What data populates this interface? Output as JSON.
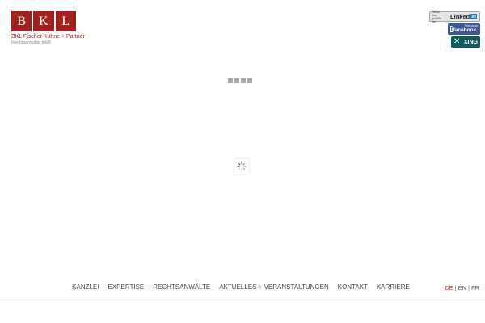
{
  "logo": {
    "letters": [
      "B",
      "K",
      "L"
    ],
    "name": "BKL Fischer Kühne + Partner",
    "subtitle": "Rechtsanwälte mbB",
    "color": "#a3221f"
  },
  "social": {
    "linkedin": {
      "small_text": "View my profile on",
      "brand": "Linked",
      "box": "in"
    },
    "facebook": {
      "small_text": "Find us on",
      "brand": "facebook."
    },
    "xing": {
      "brand": "XING"
    }
  },
  "nav": {
    "items": [
      "KANZLEI",
      "EXPERTISE",
      "RECHTSANWÄLTE",
      "AKTUELLES + VERANSTALTUNGEN",
      "KONTAKT",
      "KARRIERE"
    ]
  },
  "lang": {
    "de": "DE",
    "en": "EN",
    "fr": "FR",
    "separator": "|",
    "active_color": "#c8201c"
  },
  "icons": {
    "loader": "loading-dots-icon",
    "spinner": "spinner-icon"
  }
}
